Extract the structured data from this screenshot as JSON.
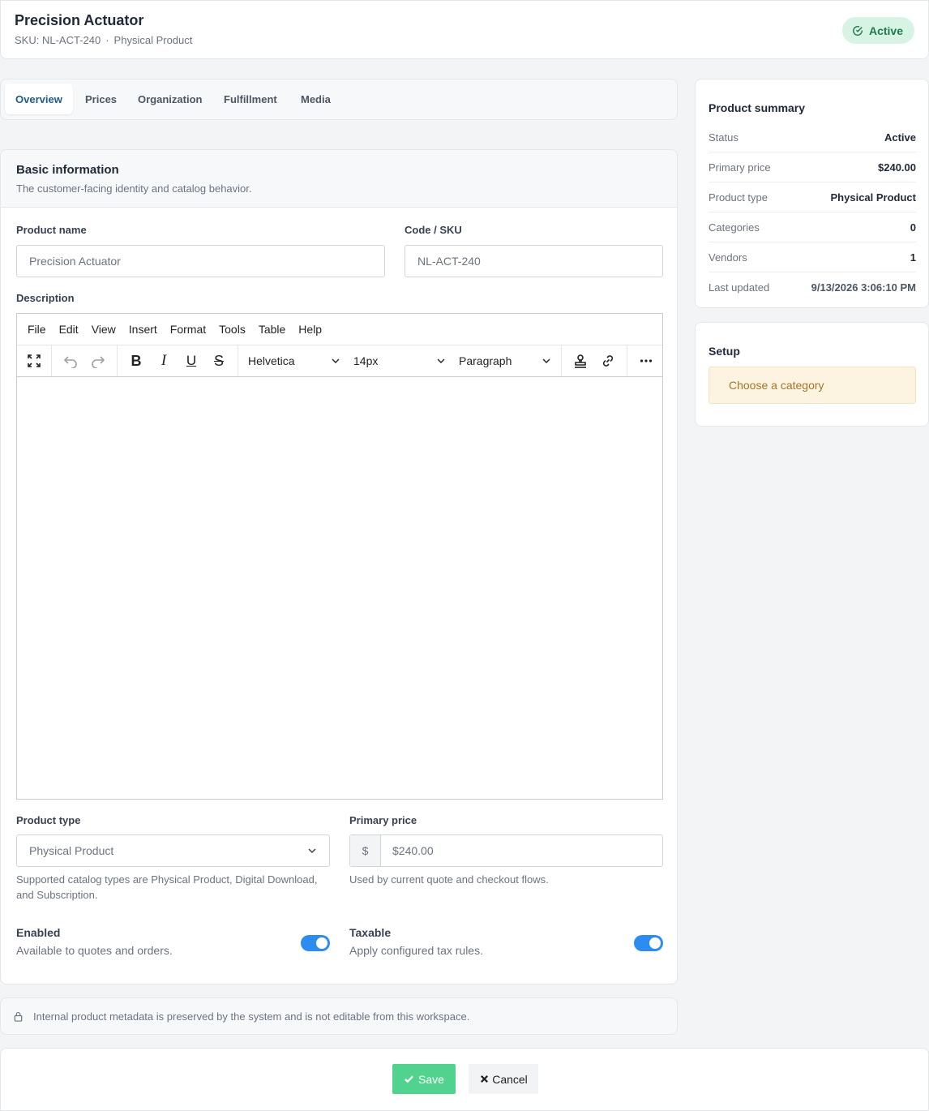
{
  "header": {
    "title": "Precision Actuator",
    "sku": "SKU: NL-ACT-240",
    "separator": "·",
    "product_type": "Physical Product",
    "status_badge": "Active"
  },
  "tabs": [
    {
      "label": "Overview",
      "active": true
    },
    {
      "label": "Prices"
    },
    {
      "label": "Organization"
    },
    {
      "label": "Fulfillment"
    },
    {
      "label": "Media"
    }
  ],
  "basic_info": {
    "title": "Basic information",
    "description": "The customer-facing identity and catalog behavior.",
    "product_name_label": "Product name",
    "product_name_placeholder": "Precision Actuator",
    "code_label": "Code / SKU",
    "code_placeholder": "NL-ACT-240",
    "description_label": "Description"
  },
  "editor": {
    "menu": [
      "File",
      "Edit",
      "View",
      "Insert",
      "Format",
      "Tools",
      "Table",
      "Help"
    ],
    "font_family": "Helvetica",
    "font_size": "14px",
    "block_format": "Paragraph",
    "content": ""
  },
  "product_type": {
    "label": "Product type",
    "value": "Physical Product",
    "help": "Supported catalog types are Physical Product, Digital Download, and Subscription."
  },
  "primary_price": {
    "label": "Primary price",
    "currency": "$",
    "placeholder": "$240.00",
    "help": "Used by current quote and checkout flows."
  },
  "toggles": {
    "enabled": {
      "title": "Enabled",
      "description": "Available to quotes and orders.",
      "on": true
    },
    "taxable": {
      "title": "Taxable",
      "description": "Apply configured tax rules.",
      "on": true
    }
  },
  "info_bar": {
    "text": "Internal product metadata is preserved by the system and is not editable from this workspace."
  },
  "footer": {
    "save_label": "Save",
    "cancel_label": "Cancel"
  },
  "summary": {
    "title": "Product summary",
    "rows": [
      {
        "key": "Status",
        "value": "Active"
      },
      {
        "key": "Primary price",
        "value": "$240.00"
      },
      {
        "key": "Product type",
        "value": "Physical Product"
      },
      {
        "key": "Categories",
        "value": "0"
      },
      {
        "key": "Vendors",
        "value": "1"
      },
      {
        "key": "Last updated",
        "value": "9/13/2026 3:06:10 PM"
      }
    ]
  },
  "setup": {
    "title": "Setup",
    "notice": "Choose a category"
  },
  "colors": {
    "accent": "#2d8cf0",
    "save_button": "#51d38f",
    "badge_bg": "#d6f3e4",
    "badge_text": "#1f7a4d",
    "notice_bg": "#fdf3e1",
    "notice_text": "#a0762b"
  }
}
